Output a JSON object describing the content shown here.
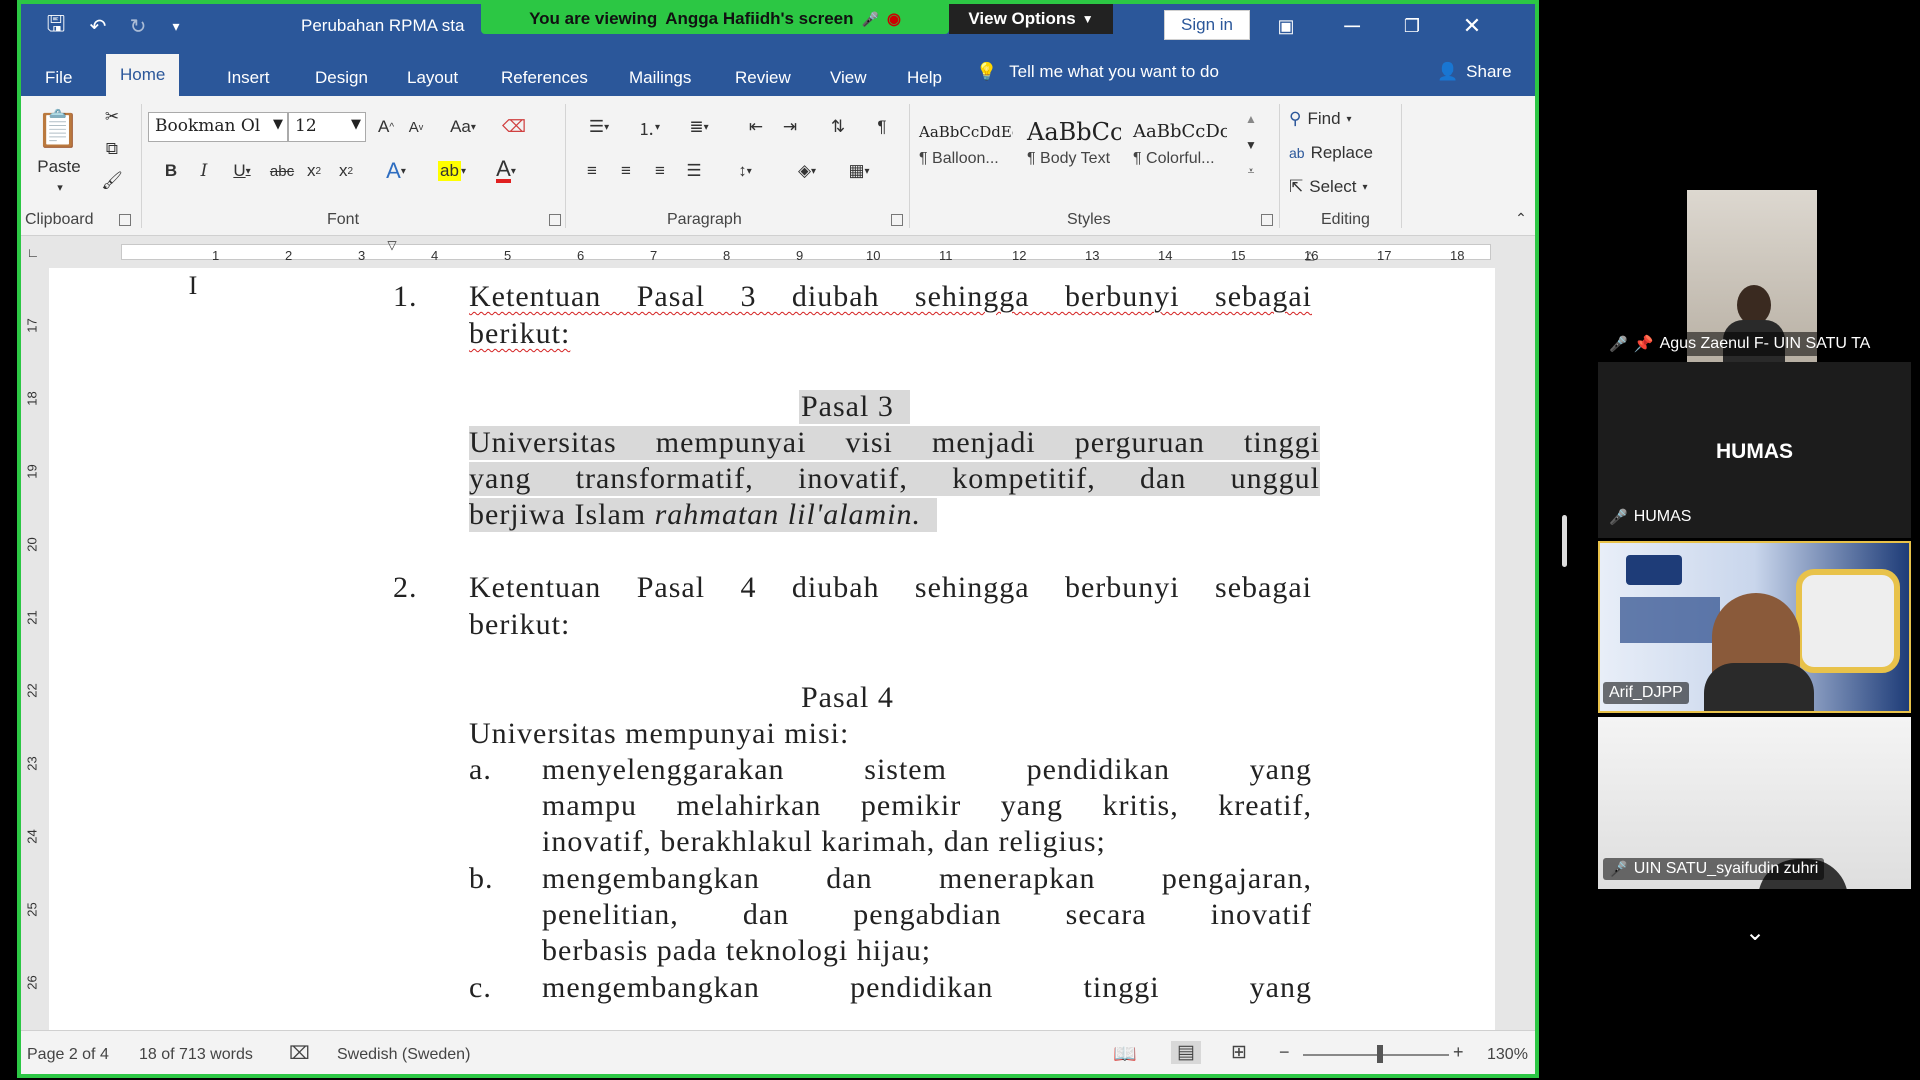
{
  "titlebar": {
    "doc_title": "Perubahan RPMA sta",
    "signin": "Sign in"
  },
  "banner": {
    "viewing_prefix": "You are viewing",
    "viewing_name": "Angga Hafiidh's screen",
    "view_options": "View Options"
  },
  "tabs": [
    {
      "label": "File"
    },
    {
      "label": "Home"
    },
    {
      "label": "Insert"
    },
    {
      "label": "Design"
    },
    {
      "label": "Layout"
    },
    {
      "label": "References"
    },
    {
      "label": "Mailings"
    },
    {
      "label": "Review"
    },
    {
      "label": "View"
    },
    {
      "label": "Help"
    }
  ],
  "tell_me": "Tell me what you want to do",
  "share": "Share",
  "ribbon": {
    "clipboard": {
      "paste": "Paste",
      "label": "Clipboard"
    },
    "font": {
      "name": "Bookman Ol",
      "size": "12",
      "label": "Font",
      "change_case": "Aa"
    },
    "paragraph": {
      "label": "Paragraph"
    },
    "styles": {
      "label": "Styles",
      "items": [
        {
          "sample": "AaBbCcDdEe",
          "name": "¶ Balloon..."
        },
        {
          "sample": "AaBbCc",
          "name": "¶ Body Text"
        },
        {
          "sample": "AaBbCcDc",
          "name": "¶ Colorful..."
        }
      ]
    },
    "editing": {
      "find": "Find",
      "replace": "Replace",
      "select": "Select",
      "label": "Editing"
    }
  },
  "ruler": {
    "h_ticks": [
      "1",
      "2",
      "3",
      "4",
      "5",
      "6",
      "7",
      "8",
      "9",
      "10",
      "11",
      "12",
      "13",
      "14",
      "15",
      "16",
      "17",
      "18"
    ],
    "v_ticks": [
      "17",
      "18",
      "19",
      "20",
      "21",
      "22",
      "23",
      "24",
      "25",
      "26"
    ]
  },
  "document": {
    "item1_num": "1.",
    "item1_line1": "Ketentuan Pasal 3 diubah sehingga berbunyi sebagai",
    "item1_line2": "berikut:",
    "pasal3_title": "Pasal 3",
    "pasal3_line1": "Universitas mempunyai visi menjadi perguruan tinggi",
    "pasal3_line2": "yang transformatif, inovatif, kompetitif, dan unggul",
    "pasal3_line3a": "berjiwa Islam ",
    "pasal3_line3b": "rahmatan lil'alamin.",
    "item2_num": "2.",
    "item2_line1": "Ketentuan Pasal 4 diubah sehingga berbunyi sebagai",
    "item2_line2": "berikut:",
    "pasal4_title": "Pasal 4",
    "pasal4_intro": "Universitas mempunyai misi:",
    "a_letter": "a.",
    "a_line1": "menyelenggarakan sistem pendidikan yang",
    "a_line2": "mampu melahirkan pemikir yang kritis, kreatif,",
    "a_line3": "inovatif, berakhlakul karimah, dan religius;",
    "b_letter": "b.",
    "b_line1": "mengembangkan dan menerapkan pengajaran,",
    "b_line2": "penelitian, dan pengabdian secara inovatif",
    "b_line3": "berbasis pada teknologi hijau;",
    "c_letter": "c.",
    "c_line1": "mengembangkan pendidikan tinggi yang"
  },
  "status": {
    "page": "Page 2 of 4",
    "words": "18 of 713 words",
    "language": "Swedish (Sweden)",
    "zoom": "130%"
  },
  "participants": [
    {
      "name": "Agus Zaenul F- UIN SATU TA"
    },
    {
      "display": "HUMAS",
      "name": "HUMAS"
    },
    {
      "name": "Arif_DJPP"
    },
    {
      "name": "UIN SATU_syaifudin zuhri"
    }
  ],
  "colors": {
    "word_blue": "#2b579a",
    "share_green": "#2cc744"
  }
}
